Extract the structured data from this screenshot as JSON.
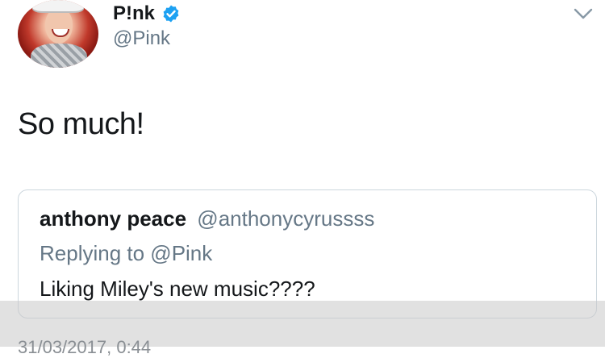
{
  "tweet": {
    "author": {
      "display_name": "P!nk",
      "handle": "@Pink",
      "verified": true,
      "avatar": "avatar-photo"
    },
    "text": "So much!",
    "menu_icon": "chevron-down-icon",
    "timestamp": "31/03/2017, 0:44"
  },
  "quoted_tweet": {
    "author_name": "anthony peace",
    "author_handle": "@anthonycyrussss",
    "replying_to": "Replying to @Pink",
    "text": "Liking Miley's new music????"
  },
  "colors": {
    "verified_badge": "#1da1f2",
    "text_primary": "#14171a",
    "text_secondary": "#657786",
    "border": "#ccd6dd"
  }
}
